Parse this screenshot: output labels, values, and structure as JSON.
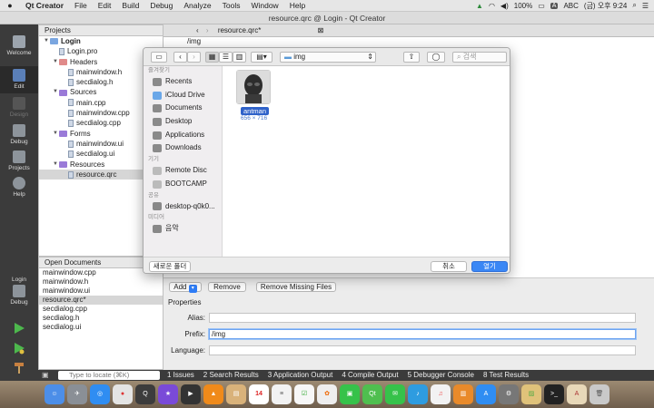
{
  "menubar": {
    "apple": "",
    "app": "Qt Creator",
    "items": [
      "File",
      "Edit",
      "Build",
      "Debug",
      "Analyze",
      "Tools",
      "Window",
      "Help"
    ],
    "battery": "100%",
    "input": "ABC",
    "clock": "(금) 오후 9:24"
  },
  "window": {
    "title": "resource.qrc @ Login - Qt Creator"
  },
  "modes": [
    {
      "label": "Welcome"
    },
    {
      "label": "Edit"
    },
    {
      "label": "Design"
    },
    {
      "label": "Debug"
    },
    {
      "label": "Projects"
    },
    {
      "label": "Help"
    }
  ],
  "run_target": {
    "label": "Login",
    "sub": "Debug"
  },
  "projects": {
    "title": "Projects",
    "tree": [
      {
        "label": "Login",
        "level": 0,
        "kind": "project"
      },
      {
        "label": "Login.pro",
        "level": 1,
        "kind": "file"
      },
      {
        "label": "Headers",
        "level": 1,
        "kind": "folder"
      },
      {
        "label": "mainwindow.h",
        "level": 2,
        "kind": "file"
      },
      {
        "label": "secdialog.h",
        "level": 2,
        "kind": "file"
      },
      {
        "label": "Sources",
        "level": 1,
        "kind": "folder"
      },
      {
        "label": "main.cpp",
        "level": 2,
        "kind": "file"
      },
      {
        "label": "mainwindow.cpp",
        "level": 2,
        "kind": "file"
      },
      {
        "label": "secdialog.cpp",
        "level": 2,
        "kind": "file"
      },
      {
        "label": "Forms",
        "level": 1,
        "kind": "folder"
      },
      {
        "label": "mainwindow.ui",
        "level": 2,
        "kind": "file"
      },
      {
        "label": "secdialog.ui",
        "level": 2,
        "kind": "file"
      },
      {
        "label": "Resources",
        "level": 1,
        "kind": "folder"
      },
      {
        "label": "resource.qrc",
        "level": 2,
        "kind": "file",
        "selected": true
      }
    ]
  },
  "open_documents": {
    "title": "Open Documents",
    "items": [
      "mainwindow.cpp",
      "mainwindow.h",
      "mainwindow.ui",
      "resource.qrc*",
      "secdialog.cpp",
      "secdialog.h",
      "secdialog.ui"
    ],
    "selected": 3
  },
  "editor": {
    "tab": "resource.qrc*",
    "path": "/img",
    "add": "Add",
    "remove": "Remove",
    "remove_missing": "Remove Missing Files",
    "properties": "Properties",
    "alias_label": "Alias:",
    "alias_value": "",
    "prefix_label": "Prefix:",
    "prefix_value": "/img",
    "language_label": "Language:",
    "language_value": ""
  },
  "locate": {
    "placeholder": "Type to locate (⌘K)"
  },
  "output_tabs": [
    "1  Issues",
    "2  Search Results",
    "3  Application Output",
    "4  Compile Output",
    "5  Debugger Console",
    "8  Test Results"
  ],
  "dialog": {
    "location": "img",
    "search_placeholder": "검색",
    "favorites_header": "즐겨찾기",
    "favorites": [
      "Recents",
      "iCloud Drive",
      "Documents",
      "Desktop",
      "Applications",
      "Downloads"
    ],
    "devices_header": "기기",
    "devices": [
      "Remote Disc",
      "BOOTCAMP"
    ],
    "shared_header": "공유",
    "shared": [
      "desktop-q0k0..."
    ],
    "media_header": "미디어",
    "media": [
      "음악"
    ],
    "file": {
      "name": "antman",
      "size": "656 × 716"
    },
    "new_folder": "새로운 폴더",
    "cancel": "취소",
    "open": "열기"
  },
  "dock": {
    "date": "14"
  }
}
